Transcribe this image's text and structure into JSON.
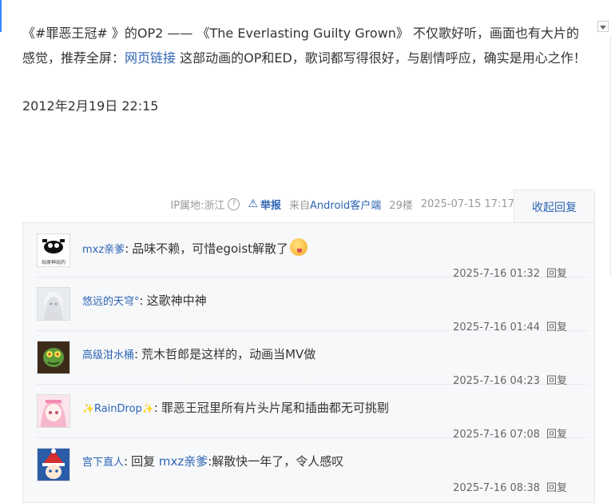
{
  "post": {
    "text_before_link": "《#罪恶王冠# 》的OP2 —— 《The Everlasting Guilty Grown》 不仅歌好听，画面也有大片的感觉，推荐全屏：",
    "link_label": "网页链接",
    "text_after_link": " 这部动画的OP和ED，歌词都写得很好，与剧情呼应，确实是用心之作！",
    "date": "2012年2月19日 22:15"
  },
  "meta": {
    "ip": "IP属地:浙江",
    "report": "举报",
    "source_prefix": "来自",
    "source": "Android客户端",
    "floor": "29楼",
    "time": "2025-07-15 17:17",
    "collapse": "收起回复"
  },
  "replies": [
    {
      "user": "mxz亲爹",
      "sep": ":",
      "content": "品味不赖，可惜egoist解散了",
      "time": "2025-7-16 01:32",
      "action": "回复",
      "avatar_text": "玩原神玩的"
    },
    {
      "user": "悠远的天穹°",
      "sep": ":",
      "content": "这歌神中神",
      "time": "2025-7-16 01:44",
      "action": "回复"
    },
    {
      "user": "高级泔水桶",
      "sep": ":",
      "content": "荒木哲郎是这样的，动画当MV做",
      "time": "2025-7-16 04:23",
      "action": "回复"
    },
    {
      "user": "RainDrop",
      "sep": ":",
      "content": "罪恶王冠里所有片头片尾和插曲都无可挑剔",
      "time": "2025-7-16 07:08",
      "action": "回复"
    },
    {
      "user": "宫下直人",
      "sep": ":",
      "prefix": "回复 ",
      "mention": "mxz亲爹",
      "content": ":解散快一年了，令人感叹",
      "time": "2025-7-16 08:38",
      "action": "回复"
    }
  ]
}
